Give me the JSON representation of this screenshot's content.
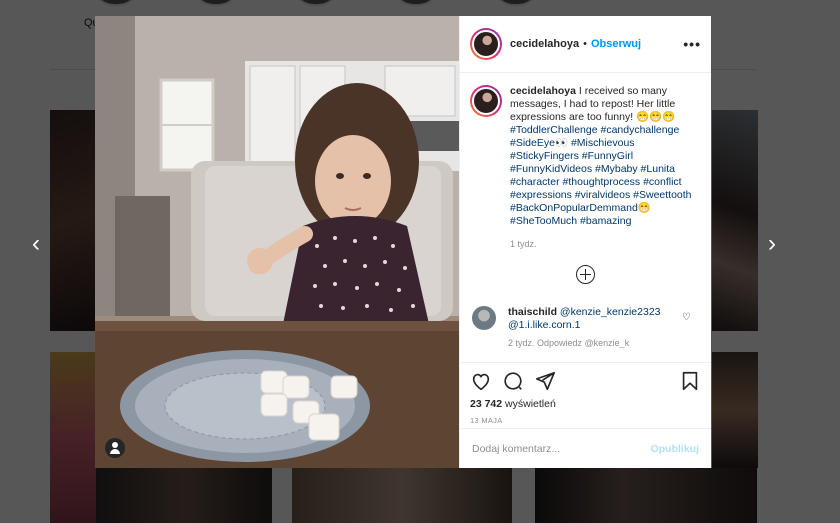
{
  "background": {
    "label": "Qu",
    "nav_prev": "‹",
    "nav_next": "›"
  },
  "post": {
    "header": {
      "username": "cecidelahoya",
      "separator": "•",
      "follow_label": "Obserwuj",
      "more_label": "•••"
    },
    "caption": {
      "username": "cecidelahoya",
      "text": " I received so many messages, I had to repost! Her little expressions are too funny! 😁😁😁",
      "hashtags": " #ToddlerChallenge #candychallenge #SideEye👀 #Mischievous #StickyFingers #FunnyGirl #FunnyKidVideos #Mybaby #Lunita #character #thoughtprocess #conflict #expressions #viralvideos #Sweettooth #BackOnPopularDemmand😁 #SheTooMuch #bamazing",
      "time": "1 tydz."
    },
    "comment": {
      "username": "thaischild",
      "text": " @kenzie_kenzie2323 @1.i.like.corn.1",
      "faded": "2 tydz.  Odpowiedz  @kenzie_k"
    },
    "stats": {
      "views": "23 742",
      "views_label": " wyświetleń",
      "date": "13 maja"
    },
    "comment_input": {
      "placeholder": "Dodaj komentarz...",
      "publish_label": "Opublikuj"
    }
  },
  "colors": {
    "link": "#0095f6",
    "hashtag": "#00376b",
    "publish_disabled": "#b2dffc"
  }
}
